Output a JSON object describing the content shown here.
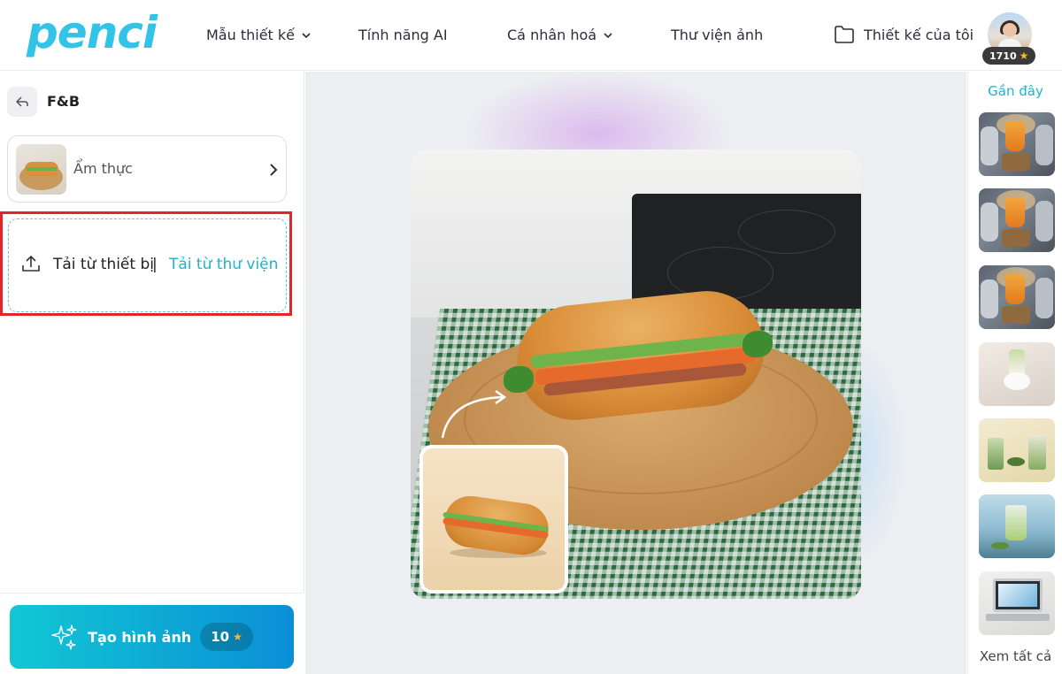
{
  "header": {
    "logo": "penci",
    "nav": [
      {
        "label": "Mẫu thiết kế",
        "has_dropdown": true
      },
      {
        "label": "Tính năng AI",
        "has_dropdown": false
      },
      {
        "label": "Cá nhân hoá",
        "has_dropdown": true
      },
      {
        "label": "Thư viện ảnh",
        "has_dropdown": false
      }
    ],
    "my_designs": "Thiết kế của tôi",
    "points": "1710"
  },
  "sidebar": {
    "title": "F&B",
    "category": {
      "label": "Ẩm thực"
    },
    "upload": {
      "from_device": "Tải từ thiết bị",
      "separator": "|",
      "from_library": "Tải từ thư viện"
    },
    "generate": {
      "label": "Tạo hình ảnh",
      "cost": "10"
    }
  },
  "right_panel": {
    "title": "Gần đây",
    "see_all": "Xem tất cả",
    "thumbnails": [
      "robot-juice",
      "robot-juice",
      "robot-juice",
      "matcha-splash",
      "matcha-latte",
      "matcha-seaside",
      "laptop-mockup"
    ]
  },
  "colors": {
    "brand": "#33c3e6",
    "accent_text": "#20b3cb",
    "highlight_border": "#e5232b",
    "button_gradient_start": "#12c7d4",
    "button_gradient_end": "#0a8fd6",
    "star": "#f5b82e"
  }
}
